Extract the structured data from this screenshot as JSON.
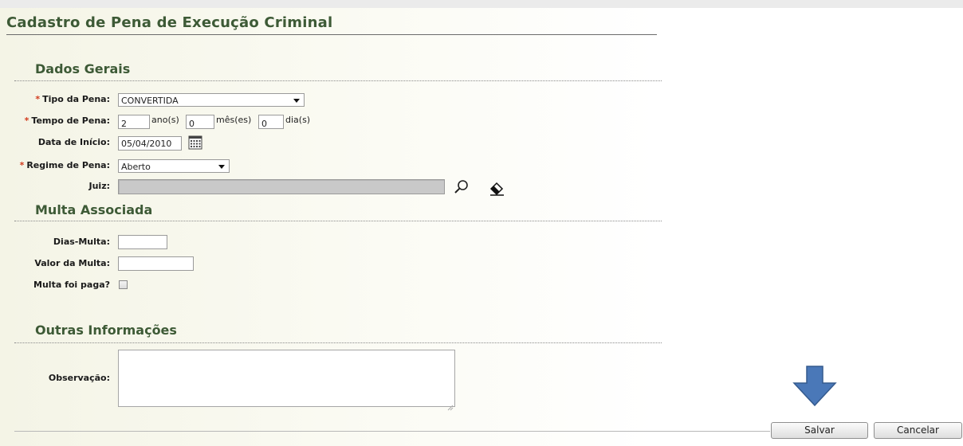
{
  "page": {
    "title": "Cadastro de Pena de Execução Criminal"
  },
  "sections": {
    "dados_gerais": "Dados Gerais",
    "multa_associada": "Multa Associada",
    "outras_informacoes": "Outras Informações"
  },
  "required_mark": "*",
  "tipo_pena": {
    "label": "Tipo da Pena:",
    "value": "CONVERTIDA"
  },
  "tempo_pena": {
    "label": "Tempo de Pena:",
    "anos": "2",
    "anos_unit": "ano(s)",
    "meses": "0",
    "meses_unit": "mês(es)",
    "dias": "0",
    "dias_unit": "dia(s)"
  },
  "data_inicio": {
    "label": "Data de Início:",
    "value": "05/04/2010",
    "icon": "calendar-icon"
  },
  "regime_pena": {
    "label": "Regime de Pena:",
    "value": "Aberto"
  },
  "juiz": {
    "label": "Juiz:",
    "value": "",
    "search_icon": "search-icon",
    "clear_icon": "eraser-icon"
  },
  "dias_multa": {
    "label": "Dias-Multa:",
    "value": ""
  },
  "valor_multa": {
    "label": "Valor da Multa:",
    "value": ""
  },
  "multa_paga": {
    "label": "Multa foi paga?",
    "checked": false
  },
  "observacao": {
    "label": "Observação:",
    "value": ""
  },
  "buttons": {
    "save": "Salvar",
    "cancel": "Cancelar"
  },
  "annotation": {
    "icon": "arrow-down-icon",
    "color": "#4a78b8"
  },
  "colors": {
    "section_title": "#3d5a36",
    "required": "#d23c1e"
  }
}
